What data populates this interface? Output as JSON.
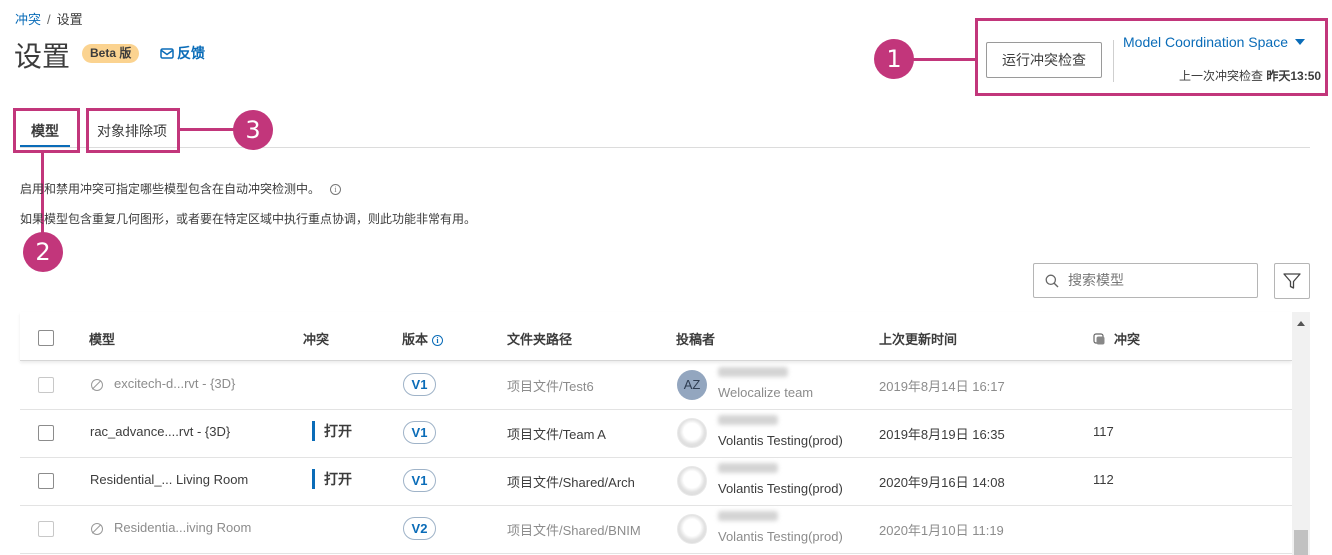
{
  "breadcrumb": {
    "parent": "冲突",
    "separator": "/",
    "current": "设置"
  },
  "header": {
    "title": "设置",
    "badge": "Beta 版",
    "feedback_label": "反馈",
    "feedback_icon": "mail-icon",
    "run_button_label": "运行冲突检查",
    "space_name": "Model Coordination Space",
    "last_check_label": "上一次冲突检查",
    "last_check_time": "昨天13:50"
  },
  "callouts": [
    "1",
    "2",
    "3"
  ],
  "tabs": [
    {
      "label": "模型",
      "active": true
    },
    {
      "label": "对象排除项",
      "active": false
    }
  ],
  "description": [
    "启用和禁用冲突可指定哪些模型包含在自动冲突检测中。",
    "如果模型包含重复几何图形，或者要在特定区域中执行重点协调，则此功能非常有用。"
  ],
  "search": {
    "placeholder": "搜索模型"
  },
  "table": {
    "headers": {
      "model": "模型",
      "clash": "冲突",
      "version": "版本",
      "folder": "文件夹路径",
      "publisher": "投稿者",
      "updated": "上次更新时间",
      "clash_count": "冲突"
    },
    "rows": [
      {
        "model": "excitech-d...rvt - {3D}",
        "status": "",
        "version": "V1",
        "folder": "项目文件/Test6",
        "avatar": "AZ",
        "team": "Welocalize team",
        "updated": "2019年8月14日 16:17",
        "count": "",
        "disabled": true
      },
      {
        "model": "rac_advance....rvt - {3D}",
        "status": "打开",
        "version": "V1",
        "folder": "项目文件/Team A",
        "avatar": "",
        "team": "Volantis Testing(prod)",
        "updated": "2019年8月19日 16:35",
        "count": "117",
        "disabled": false
      },
      {
        "model": "Residential_... Living Room",
        "status": "打开",
        "version": "V1",
        "folder": "项目文件/Shared/Arch",
        "avatar": "",
        "team": "Volantis Testing(prod)",
        "updated": "2020年9月16日 14:08",
        "count": "112",
        "disabled": false
      },
      {
        "model": "Residentia...iving Room",
        "status": "",
        "version": "V2",
        "folder": "项目文件/Shared/BNIM",
        "avatar": "",
        "team": "Volantis Testing(prod)",
        "updated": "2020年1月10日 11:19",
        "count": "",
        "disabled": true
      }
    ]
  },
  "colors": {
    "accent": "#0a6cb8",
    "highlight": "#c2367b",
    "badge": "#fbd390"
  }
}
